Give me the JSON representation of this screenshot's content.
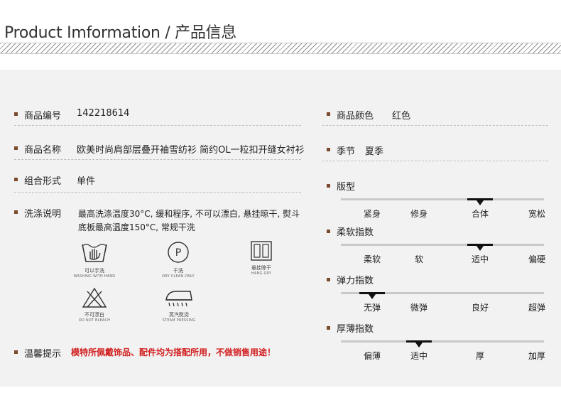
{
  "header": {
    "title": "Product Imformation / 产品信息"
  },
  "left": {
    "product_code_label": "商品编号",
    "product_code_value": "142218614",
    "product_name_label": "商品名称",
    "product_name_value": "欧美时尚肩部层叠开袖雪纺衫 简约OL一粒扣开缝女衬衫",
    "combo_label": "组合形式",
    "combo_value": "单件",
    "wash_label": "洗涤说明",
    "wash_line1": "最高洗涤温度30°C, 缓和程序, 不可以漂白, 悬挂晾干, 熨斗",
    "wash_line2": "底板最高温度150°C, 常规干洗",
    "care_icons": [
      {
        "icon": "hand-wash-icon",
        "cn": "可以手洗",
        "en": "WASHING WITH HAND"
      },
      {
        "icon": "dry-clean-icon",
        "cn": "干洗",
        "en": "DRY CLEAN ONLY"
      },
      {
        "icon": "hang-dry-icon",
        "cn": "悬挂晾干",
        "en": "HANG DRY"
      },
      {
        "icon": "no-bleach-icon",
        "cn": "不可漂白",
        "en": "DO NOT BLEACH"
      },
      {
        "icon": "steam-iron-icon",
        "cn": "蒸汽熨烫",
        "en": "STEAM PRESSING"
      }
    ],
    "dry_clean_letter": "P",
    "tip_label": "温馨提示",
    "tip_value": "模特所佩戴饰品、配件均为搭配所用，不做销售用途！"
  },
  "right": {
    "color_label": "商品颜色",
    "color_value": "红色",
    "season_label": "季节",
    "season_value": "夏季",
    "scales": [
      {
        "label": "版型",
        "options": [
          "紧身",
          "修身",
          "合体",
          "宽松"
        ],
        "selected": 2
      },
      {
        "label": "柔软指数",
        "options": [
          "柔软",
          "软",
          "适中",
          "偏硬"
        ],
        "selected": 2
      },
      {
        "label": "弹力指数",
        "options": [
          "无弹",
          "微弹",
          "良好",
          "超弹"
        ],
        "selected": 0
      },
      {
        "label": "厚薄指数",
        "options": [
          "偏薄",
          "适中",
          "厚",
          "加厚"
        ],
        "selected": 1
      }
    ]
  },
  "colors": {
    "bullet": "#7b4a2c",
    "warning": "#d21f1f",
    "panel_bg": "#f2f2f2"
  }
}
